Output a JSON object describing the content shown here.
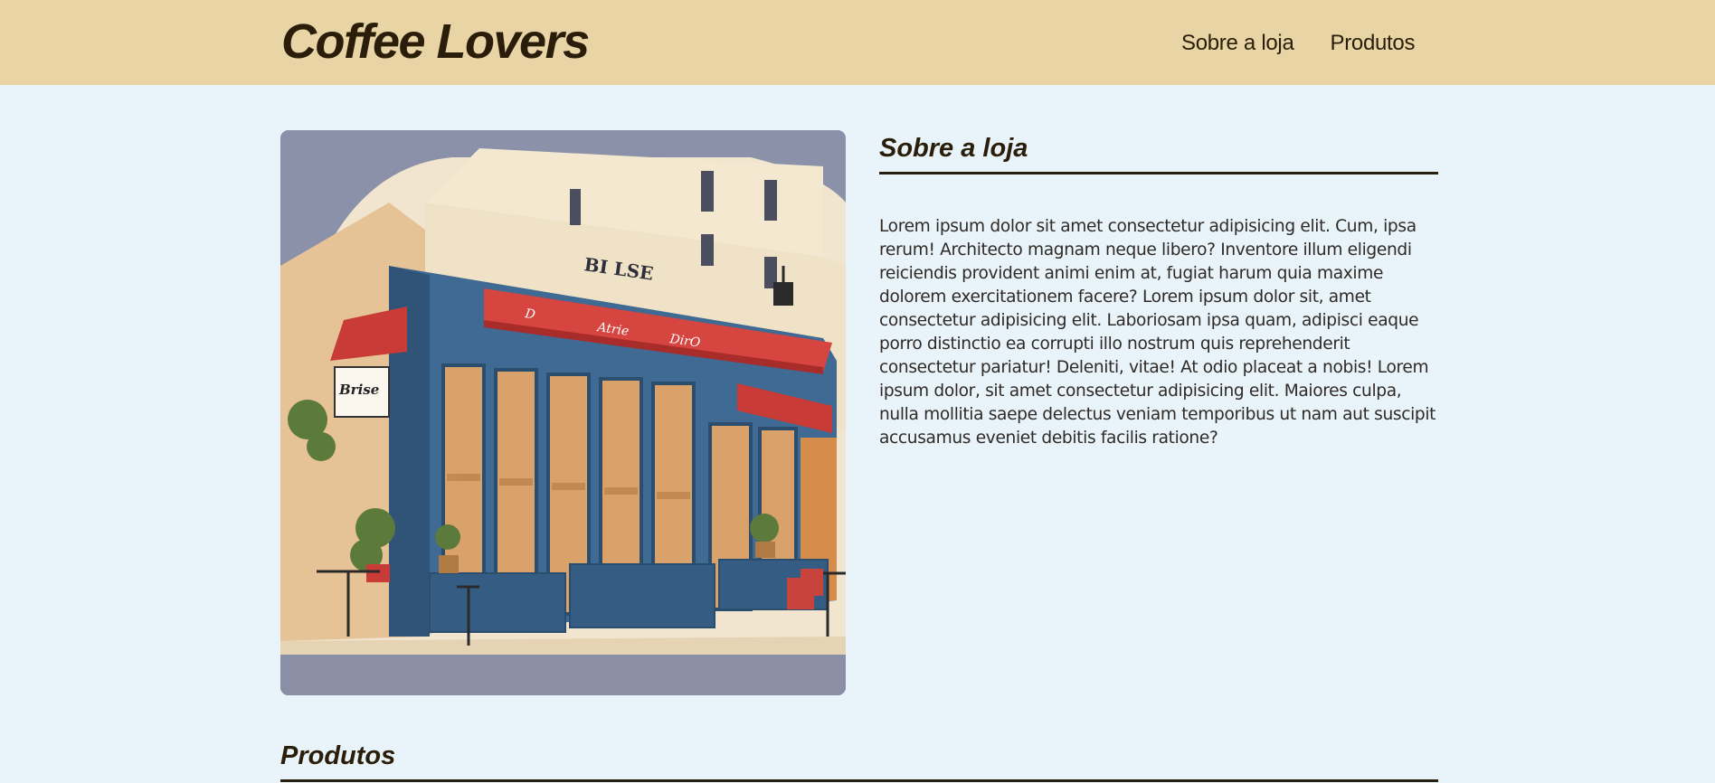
{
  "header": {
    "brand": "Coffee Lovers",
    "nav": [
      "Sobre a loja",
      "Produtos"
    ]
  },
  "store_image": {
    "alt": "Ilustração da fachada de um café",
    "sign_text": "BI LSE",
    "board_text": "Brise",
    "awning_text": [
      "D",
      "Atrie",
      "DirO"
    ]
  },
  "about": {
    "title": "Sobre a loja",
    "body": "Lorem ipsum dolor sit amet consectetur adipisicing elit. Cum, ipsa rerum! Architecto magnam neque libero? Inventore illum eligendi reiciendis provident animi enim at, fugiat harum quia maxime dolorem exercitationem facere? Lorem ipsum dolor sit, amet consectetur adipisicing elit. Laboriosam ipsa quam, adipisci eaque porro distinctio ea corrupti illo nostrum quis reprehenderit consectetur pariatur! Deleniti, vitae! At odio placeat a nobis! Lorem ipsum dolor, sit amet consectetur adipisicing elit. Maiores culpa, nulla mollitia saepe delectus veniam temporibus ut nam aut suscipit accusamus eveniet debitis facilis ratione?"
  },
  "products": {
    "title": "Produtos"
  },
  "colors": {
    "header_bg": "#e8d4a5",
    "page_bg": "#e8f3fa",
    "text_dark": "#2a1e0a",
    "awning_red": "#d6453f",
    "facade_blue": "#3e6a94"
  }
}
